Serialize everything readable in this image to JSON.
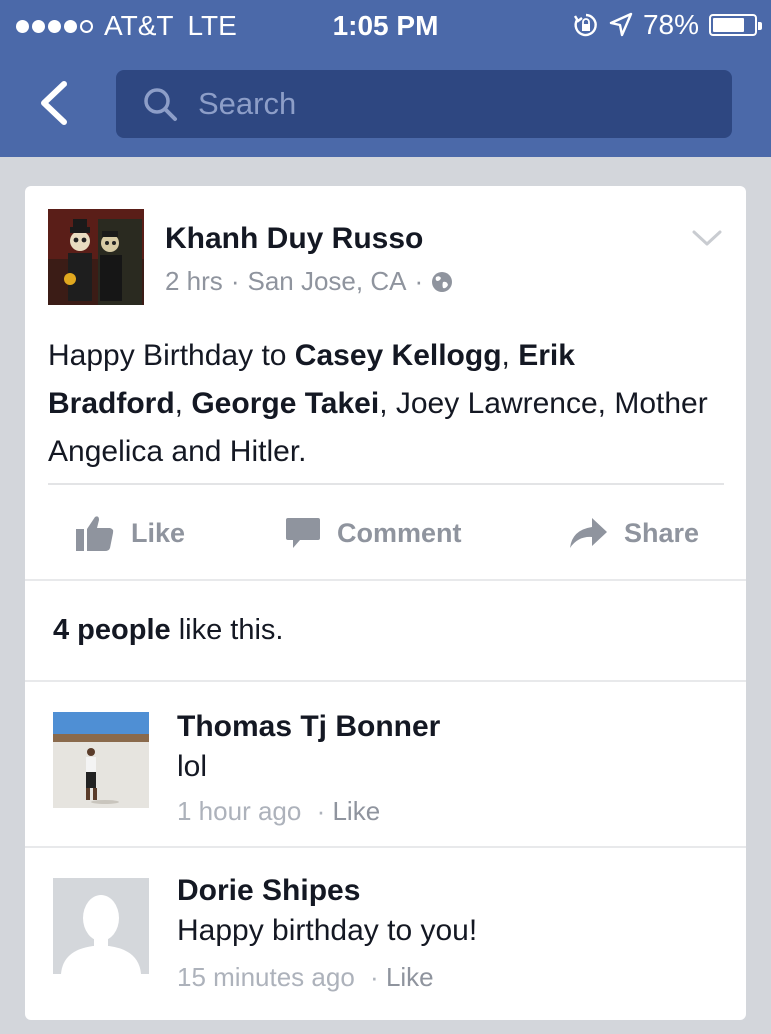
{
  "status_bar": {
    "carrier": "AT&T",
    "network": "LTE",
    "time": "1:05 PM",
    "battery": "78%",
    "battery_level": 0.78,
    "signal_bars": 4,
    "signal_total": 5
  },
  "search": {
    "placeholder": "Search"
  },
  "post": {
    "author": "Khanh Duy Russo",
    "time": "2 hrs",
    "location": "San Jose, CA",
    "separator": "·",
    "text_parts": {
      "p1": "Happy Birthday to ",
      "p2": "Casey Kellogg",
      "p3": ", ",
      "p4": "Erik Bradford",
      "p5": ", ",
      "p6": "George Takei",
      "p7": ", Joey Lawrence, Mother Angelica and Hitler."
    },
    "actions": {
      "like": "Like",
      "comment": "Comment",
      "share": "Share"
    },
    "likes": {
      "count": "4 people",
      "suffix": " like this."
    }
  },
  "comments": [
    {
      "name": "Thomas Tj Bonner",
      "text": "lol",
      "time": "1 hour ago",
      "like": "Like"
    },
    {
      "name": "Dorie Shipes",
      "text": "Happy birthday to you!",
      "time": "15 minutes ago",
      "like": "Like"
    }
  ],
  "colors": {
    "header": "#4b69a9",
    "search_bg": "#2e4781",
    "text": "#141823",
    "muted": "#8f949e"
  }
}
